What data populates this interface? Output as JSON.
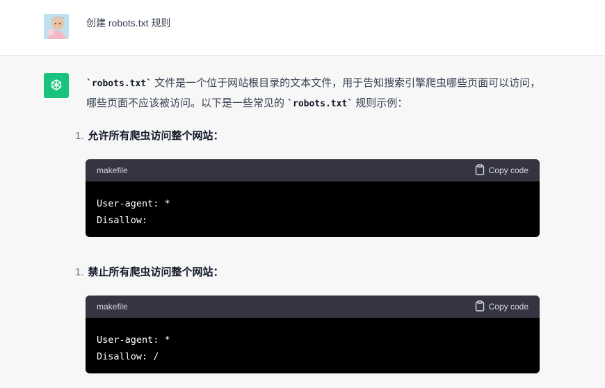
{
  "user_message": {
    "text": "创建 robots.txt 规则"
  },
  "assistant": {
    "intro_part1": "`robots.txt`",
    "intro_part2": " 文件是一个位于网站根目录的文本文件，用于告知搜索引擎爬虫哪些页面可以访问，哪些页面不应该被访问。以下是一些常见的 ",
    "intro_part3": "`robots.txt`",
    "intro_part4": " 规则示例：",
    "items": [
      {
        "number": "1.",
        "title": "允许所有爬虫访问整个网站：",
        "code_lang": "makefile",
        "copy_label": "Copy code",
        "code": "User-agent: *\nDisallow:"
      },
      {
        "number": "1.",
        "title": "禁止所有爬虫访问整个网站：",
        "code_lang": "makefile",
        "copy_label": "Copy code",
        "code": "User-agent: *\nDisallow: /"
      }
    ]
  },
  "colors": {
    "gpt_brand": "#19c37d",
    "code_header": "#343541",
    "code_body": "#000000",
    "assistant_bg": "#f7f7f8"
  },
  "icons": {
    "user_avatar": "user-avatar-image",
    "assistant_logo": "openai-logo-icon",
    "copy": "clipboard-icon"
  }
}
